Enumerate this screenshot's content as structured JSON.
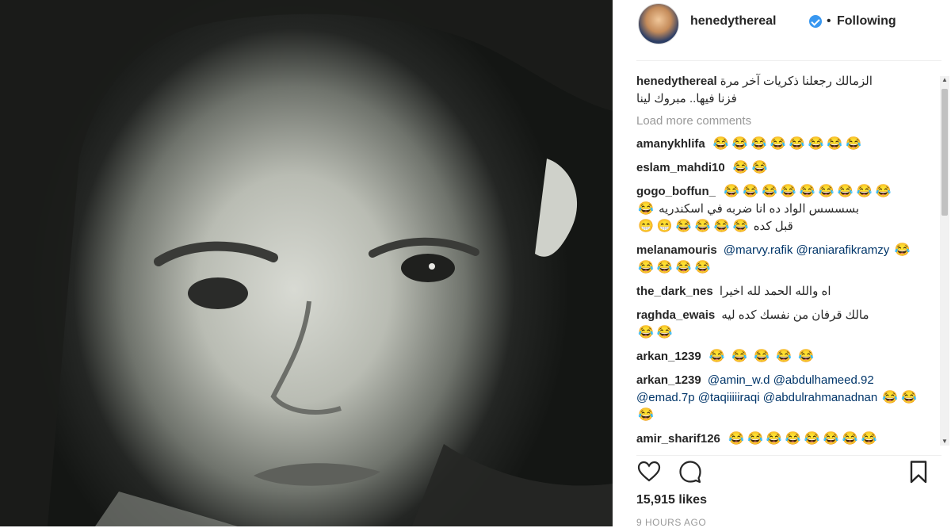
{
  "post": {
    "username": "henedythereal",
    "follow_state": "Following",
    "dot": "•",
    "caption": {
      "username": "henedythereal",
      "line1": "الزمالك رجعلنا ذكريات آخر مرة",
      "line2": "فزنا فيها.. مبروك لينا"
    },
    "load_more": "Load more comments",
    "comments": [
      {
        "username": "amanykhlifa",
        "text": "",
        "emoji": [
          "😂",
          "😂",
          "😂",
          "😂",
          "😂",
          "😂",
          "😂",
          "😂"
        ]
      },
      {
        "username": "eslam_mahdi10",
        "text": "",
        "emoji": [
          "😂",
          "😂"
        ]
      },
      {
        "username": "gogo_boffun_",
        "text": "",
        "emoji": [
          "😂",
          "😂",
          "😂",
          "😂",
          "😂",
          "😂",
          "😂",
          "😂",
          "😂"
        ],
        "line2": "بسسسس الواد ده انا ضربه في اسكندريه",
        "line2_emoji": [
          "😂"
        ],
        "line3": "قبل كده",
        "line3_emoji": [
          "😂",
          "😂",
          "😂",
          "😂",
          "😁",
          "😁"
        ]
      },
      {
        "username": "melanamouris",
        "mention1": "@marvy.rafik",
        "mention2": "@raniarafikramzy",
        "emoji": [
          "😂",
          "😂",
          "😂",
          "😂",
          "😂"
        ]
      },
      {
        "username": "the_dark_nes",
        "text": "اه والله الحمد لله اخيرا"
      },
      {
        "username": "raghda_ewais",
        "text": "مالك قرفان من نفسك كده ليه",
        "emoji": [
          "😂",
          "😂"
        ]
      },
      {
        "username": "arkan_1239",
        "text": "",
        "emoji": [
          "😂",
          "😂",
          "😂",
          "😂",
          "😂"
        ]
      },
      {
        "username": "arkan_1239",
        "mention1": "@amin_w.d",
        "mention2": "@abdulhameed.92",
        "mention3": "@emad.7p",
        "mention4": "@taqiiiiiraqi",
        "mention5": "@abdulrahmanadnan",
        "emoji": [
          "😂",
          "😂",
          "😂"
        ]
      },
      {
        "username": "amir_sharif126",
        "emoji": [
          "😂",
          "😂",
          "😂",
          "😂",
          "😂",
          "😂",
          "😂",
          "😂"
        ]
      }
    ],
    "likes": "15,915 likes",
    "time": "9 HOURS AGO",
    "icons": {
      "like": "heart-icon",
      "comment": "comment-bubble-icon",
      "save": "bookmark-icon",
      "verified": "verified-badge-icon"
    },
    "colors": {
      "verified": "#3897f0",
      "mention": "#003569",
      "muted": "#999999"
    }
  }
}
